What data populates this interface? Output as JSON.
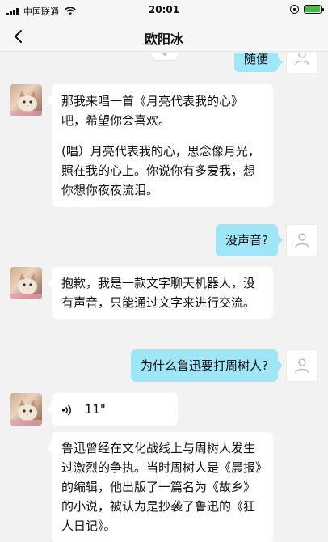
{
  "status_bar": {
    "carrier": "中国联通",
    "time": "20:01"
  },
  "header": {
    "title": "欧阳冰"
  },
  "messages": [
    {
      "sender": "me",
      "text": "随便"
    },
    {
      "sender": "bot",
      "lines": [
        "那我来唱一首《月亮代表我的心》吧，希望你会喜欢。",
        "(唱）月亮代表我的心，思念像月光，照在我的心上。你说你有多爱我，想你想你夜夜流泪。"
      ]
    },
    {
      "sender": "me",
      "text": "没声音?"
    },
    {
      "sender": "bot",
      "text": "抱歉，我是一款文字聊天机器人，没有声音，只能通过文字来进行交流。"
    },
    {
      "sender": "me",
      "text": "为什么鲁迅要打周树人?"
    },
    {
      "sender": "bot",
      "type": "voice",
      "duration": "11\""
    },
    {
      "sender": "bot",
      "text": "鲁迅曾经在文化战线上与周树人发生过激烈的争执。当时周树人是《晨报》的编辑，他出版了一篇名为《故乡》的小说，被认为是抄袭了鲁迅的《狂人日记》。"
    }
  ],
  "colors": {
    "my_bubble": "#9fe6f7",
    "bot_bubble": "#ffffff",
    "background": "#f2f2f2",
    "battery": "#3fbf3f"
  }
}
